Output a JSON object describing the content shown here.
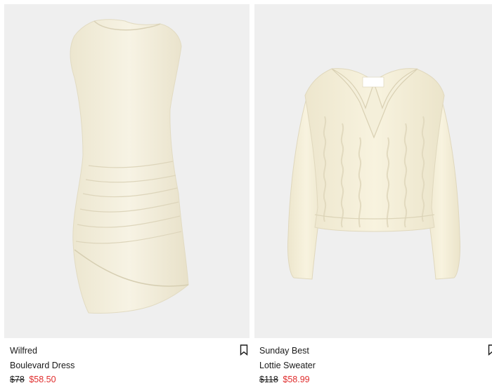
{
  "products": [
    {
      "brand": "Wilfred",
      "name": "Boulevard Dress",
      "original_price": "$78",
      "sale_price": "$58.50"
    },
    {
      "brand": "Sunday Best",
      "name": "Lottie Sweater",
      "original_price": "$118",
      "sale_price": "$58.99"
    }
  ],
  "colors": {
    "sale": "#e02d2d",
    "image_bg": "#efefef",
    "garment": "#f6f2e1"
  },
  "icons": {
    "save": "bookmark-icon"
  }
}
